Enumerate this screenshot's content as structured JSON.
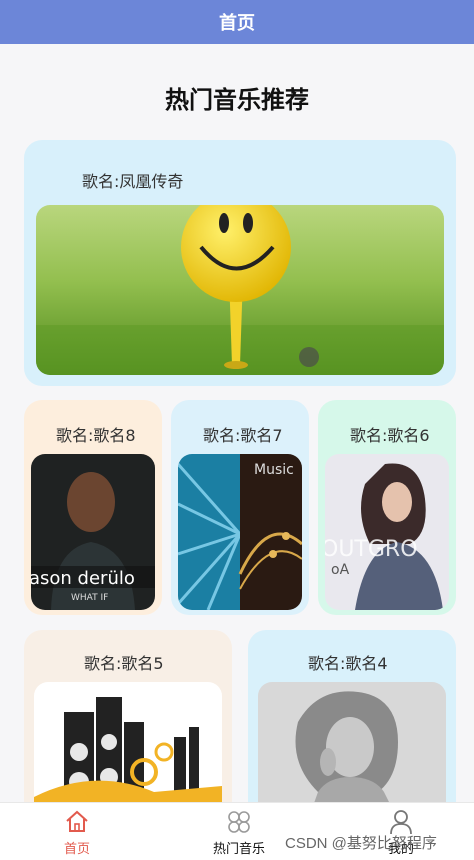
{
  "header": {
    "title": "首页"
  },
  "section": {
    "title": "热门音乐推荐"
  },
  "songs": [
    {
      "name": "歌名:凤凰传奇",
      "bg": "#d8f0fb"
    },
    {
      "name": "歌名:歌名8",
      "bg": "#fdeedd"
    },
    {
      "name": "歌名:歌名7",
      "bg": "#dcf1fb"
    },
    {
      "name": "歌名:歌名6",
      "bg": "#d6f8ea"
    },
    {
      "name": "歌名:歌名5",
      "bg": "#f8efe6"
    },
    {
      "name": "歌名:歌名4",
      "bg": "#d9f1fb"
    }
  ],
  "album_text": {
    "jason": "ason derülo",
    "jason_sub": "WHAT IF",
    "music": "Music",
    "outgrow": "OUTGRO",
    "boa": "oA"
  },
  "tabs": [
    {
      "label": "首页",
      "icon": "home-icon",
      "active": true
    },
    {
      "label": "热门音乐",
      "icon": "clover-icon",
      "active": false
    },
    {
      "label": "我的",
      "icon": "user-icon",
      "active": false
    }
  ],
  "watermark": "CSDN @基努比努程序"
}
